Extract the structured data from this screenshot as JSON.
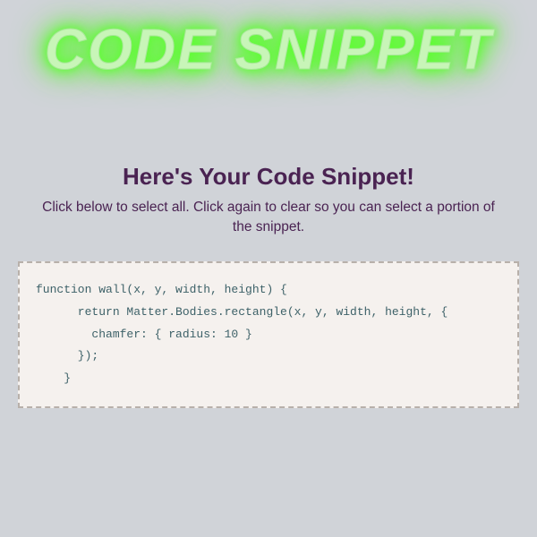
{
  "banner": {
    "title": "CODE SNIPPET"
  },
  "main": {
    "heading": "Here's Your Code Snippet!",
    "instructions": "Click below to select all. Click again to clear so you can select a portion of the snippet."
  },
  "snippet": {
    "code": "function wall(x, y, width, height) {\n      return Matter.Bodies.rectangle(x, y, width, height, {\n        chamfer: { radius: 10 }\n      });\n    }"
  }
}
